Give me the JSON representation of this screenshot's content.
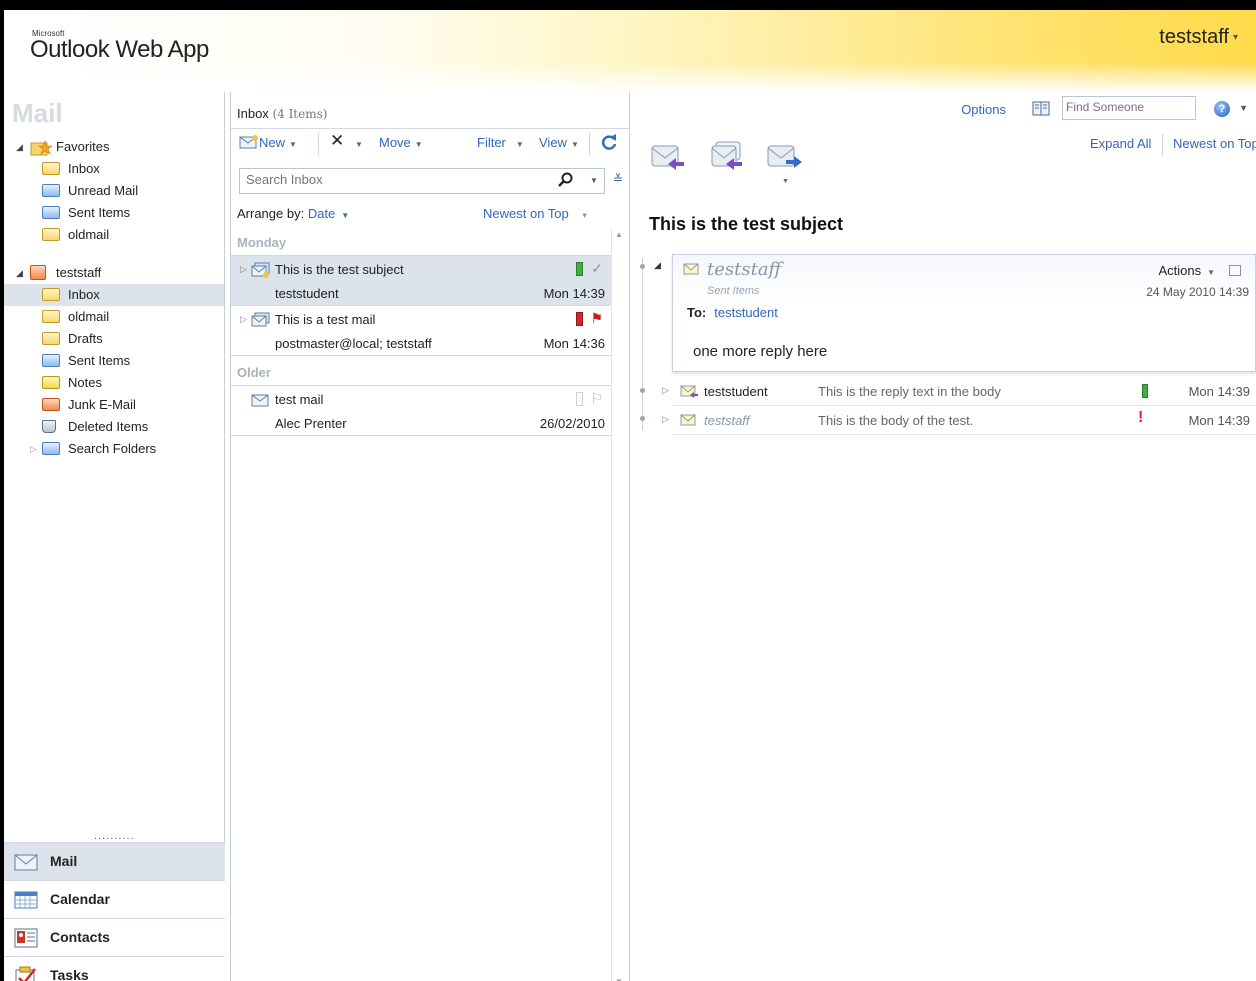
{
  "app": {
    "ms_label": "Microsoft",
    "title": "Outlook Web App",
    "user": "teststaff",
    "options": "Options",
    "find_someone_placeholder": "Find Someone"
  },
  "nav": {
    "module_title": "Mail",
    "favorites": {
      "label": "Favorites",
      "items": [
        "Inbox",
        "Unread Mail",
        "Sent Items",
        "oldmail"
      ]
    },
    "mailbox": {
      "label": "teststaff",
      "items": [
        "Inbox",
        "oldmail",
        "Drafts",
        "Sent Items",
        "Notes",
        "Junk E-Mail",
        "Deleted Items",
        "Search Folders"
      ],
      "selected": "Inbox"
    },
    "grip": "..........",
    "buttons": [
      "Mail",
      "Calendar",
      "Contacts",
      "Tasks"
    ]
  },
  "list": {
    "folder": "Inbox",
    "count": "(4 Items)",
    "toolbar": {
      "new": "New",
      "move": "Move",
      "filter": "Filter",
      "view": "View"
    },
    "search_placeholder": "Search Inbox",
    "arrange_label": "Arrange by:",
    "arrange_value": "Date",
    "sort": "Newest on Top",
    "groups": [
      {
        "name": "Monday",
        "messages": [
          {
            "subject": "This is the test subject",
            "from": "teststudent",
            "time": "Mon 14:39",
            "category_color": "#3cb043",
            "flag": "✓"
          },
          {
            "subject": "This is a test mail",
            "from": "postmaster@local; teststaff",
            "time": "Mon 14:36",
            "category_color": "#d9252a",
            "flag": "⚑"
          }
        ]
      },
      {
        "name": "Older",
        "messages": [
          {
            "subject": "test mail",
            "from": "Alec Prenter",
            "time": "26/02/2010",
            "category_color": "#ffffff",
            "flag": "⚐"
          }
        ]
      }
    ]
  },
  "reading": {
    "expand_all": "Expand All",
    "sort": "Newest on Top",
    "subject": "This is the test subject",
    "selected_message": {
      "sender": "teststaff",
      "folder": "Sent Items",
      "to_label": "To:",
      "to": "teststudent",
      "actions": "Actions",
      "date": "24 May 2010 14:39",
      "body": "one more reply here"
    },
    "thread": [
      {
        "sender": "teststudent",
        "preview": "This is the reply text in the body",
        "time": "Mon 14:39",
        "mark": "green",
        "italic": false
      },
      {
        "sender": "teststaff",
        "preview": "This is the body of the test.",
        "time": "Mon 14:39",
        "mark": "important",
        "italic": true
      }
    ]
  },
  "colors": {
    "link": "#3366bb",
    "selection": "#dde3ea",
    "header_gold": "#ffda4a"
  }
}
